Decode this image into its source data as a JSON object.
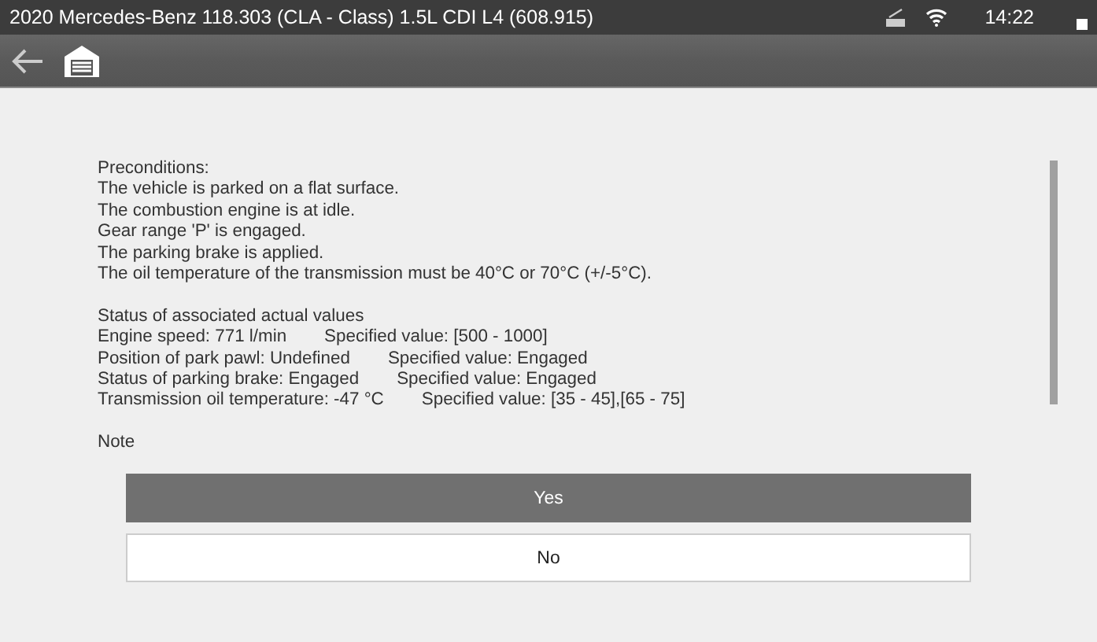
{
  "status_bar": {
    "title": "2020 Mercedes-Benz 118.303 (CLA - Class) 1.5L CDI L4 (608.915)",
    "time": "14:22"
  },
  "preconditions": {
    "heading": "Preconditions:",
    "lines": [
      "The vehicle is parked on a flat surface.",
      "The combustion engine is at idle.",
      "Gear range 'P' is engaged.",
      "The parking brake is applied.",
      "The oil temperature of the transmission must be 40°C or 70°C (+/-5°C)."
    ]
  },
  "status": {
    "heading": "Status of associated actual values",
    "rows": [
      {
        "actual": "Engine speed: 771 l/min",
        "specified": "Specified value: [500 - 1000]"
      },
      {
        "actual": "Position of park pawl: Undefined",
        "specified": "Specified value: Engaged"
      },
      {
        "actual": "Status of parking brake: Engaged",
        "specified": "Specified value: Engaged"
      },
      {
        "actual": "Transmission oil temperature: -47 °C",
        "specified": "Specified value: [35 - 45],[65 - 75]"
      }
    ]
  },
  "note": {
    "heading": "Note"
  },
  "buttons": [
    {
      "label": "Yes",
      "selected": true
    },
    {
      "label": "No",
      "selected": false
    }
  ]
}
